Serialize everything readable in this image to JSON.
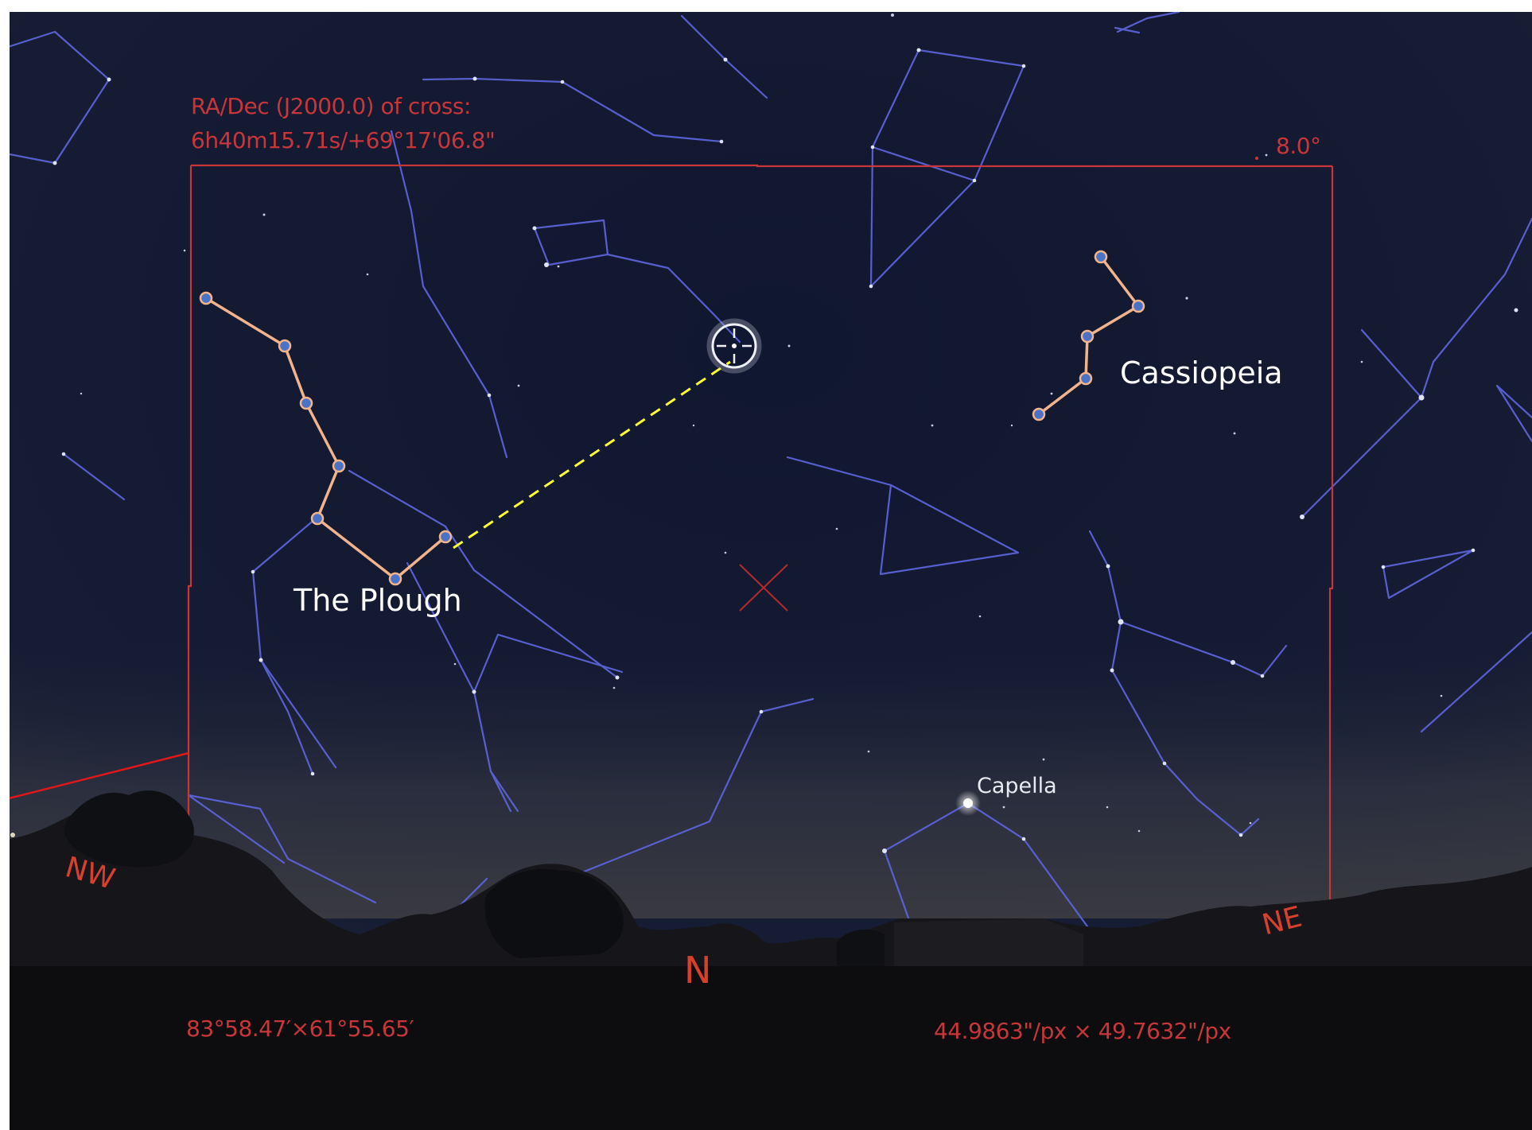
{
  "overlay": {
    "coord_label": "RA/Dec (J2000.0) of cross:",
    "coord_value": "6h40m15.71s/+69°17'06.8\"",
    "rotation": "8.0°",
    "fov_size": "83°58.47′×61°55.65′",
    "resolution": "44.9863\"/px × 49.7632\"/px"
  },
  "compass": {
    "nw": "NW",
    "n": "N",
    "ne": "NE"
  },
  "labels": {
    "plough": "The Plough",
    "cassiopeia": "Cassiopeia",
    "capella": "Capella"
  },
  "colors": {
    "sky": "#141a2e",
    "constellation_lines": "#5b63d8",
    "fov_frame": "#c8363a",
    "highlight_line": "#f2b48c",
    "highlight_node": "#4a73c7",
    "pointer_line": "#ffff33",
    "annotation_text": "#ffffff",
    "compass_text": "#d8402e"
  },
  "icons": {
    "target_reticle": "crosshair-reticle-icon",
    "center_cross": "x-cross-icon"
  }
}
